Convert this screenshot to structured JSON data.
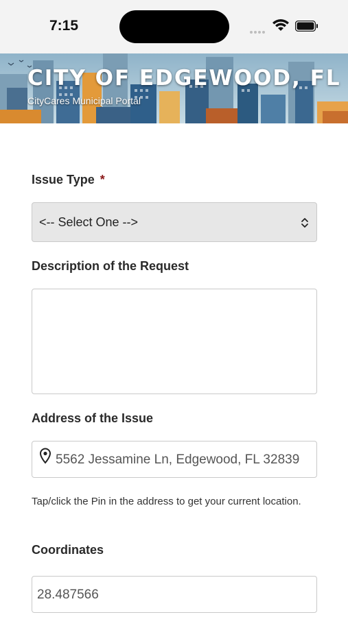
{
  "status_bar": {
    "time": "7:15",
    "signal_icon": "cellular-signal-icon",
    "wifi_icon": "wifi-icon",
    "battery_icon": "battery-icon"
  },
  "header": {
    "title": "CITY OF EDGEWOOD, FL",
    "subtitle": "CityCares Municipal Portal",
    "background_icon": "city-skyline-illustration"
  },
  "form": {
    "issue_type": {
      "label": "Issue Type",
      "required_marker": "*",
      "selected_value": "<-- Select One -->",
      "arrow_icon": "chevron-updown-icon"
    },
    "description": {
      "label": "Description of the Request",
      "value": ""
    },
    "address": {
      "label": "Address of the Issue",
      "value": "5562 Jessamine Ln, Edgewood, FL 32839",
      "pin_icon": "map-pin-icon",
      "help_text": "Tap/click the Pin in the address to get your current location."
    },
    "coordinates": {
      "label": "Coordinates",
      "value": "28.487566"
    }
  },
  "colors": {
    "required": "#8b1a1a",
    "select_bg": "#e7e7e7",
    "border": "#c9c9c9"
  }
}
